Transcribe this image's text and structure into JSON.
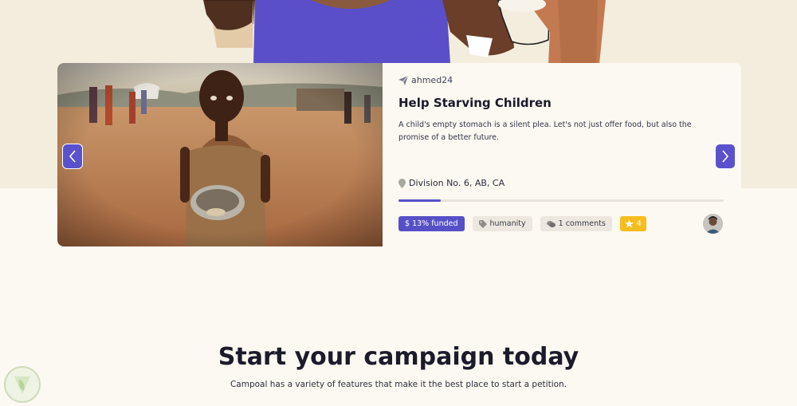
{
  "campaign": {
    "author": "ahmed24",
    "title": "Help Starving Children",
    "description": "A child's empty stomach is a silent plea. Let's not just offer food, but also the promise of a better future.",
    "location": "Division No. 6, AB, CA",
    "funded_percent": 13,
    "funded_label": "$ 13% funded",
    "category": "humanity",
    "comments": "1 comments",
    "stars": "4"
  },
  "section": {
    "title": "Start your campaign today",
    "subtitle": "Campoal has a variety of features that make it the best place to start a petition."
  },
  "icons": {
    "author": "paper-plane-icon",
    "location": "map-pin-icon",
    "category": "tag-icon",
    "comments": "chat-bubbles-icon",
    "stars": "star-icon",
    "prev": "chevron-left-icon",
    "next": "chevron-right-icon"
  },
  "colors": {
    "accent": "#5650c8",
    "star": "#f7bd1e",
    "background": "#fcf9f2",
    "hero_band": "#f3eddd"
  }
}
